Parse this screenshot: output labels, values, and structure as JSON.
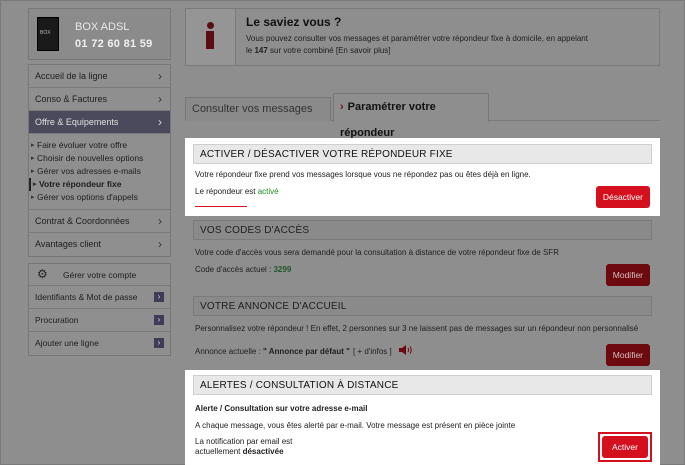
{
  "account_box": {
    "title": "BOX ADSL",
    "number": "01 72 60 81 59",
    "device_icon": "box-adsl-device-icon",
    "device_label": "BOX"
  },
  "menu": {
    "items": [
      {
        "label": "Accueil de la ligne"
      },
      {
        "label": "Conso & Factures"
      },
      {
        "label": "Offre & Equipements"
      }
    ],
    "submenu": [
      {
        "label": "Faire évoluer votre offre"
      },
      {
        "label": "Choisir de nouvelles options"
      },
      {
        "label": "Gérer vos adresses e-mails"
      },
      {
        "label": "Votre répondeur fixe"
      },
      {
        "label": "Gérer vos options d'appels"
      }
    ],
    "items_after": [
      {
        "label": "Contrat & Coordonnées"
      },
      {
        "label": "Avantages client"
      }
    ],
    "chevron": "›"
  },
  "account": {
    "header": "Gérer votre compte",
    "gear_icon": "gear-icon",
    "items": [
      {
        "label": "Identifiants & Mot de passe"
      },
      {
        "label": "Procuration"
      },
      {
        "label": "Ajouter une ligne"
      }
    ],
    "arrow": "›"
  },
  "info": {
    "title": "Le saviez vous ?",
    "line1": "Vous pouvez consulter vos messages et paramétrer votre répondeur fixe à domicile, en appelant",
    "line2_prefix": "le ",
    "line2_number": "147",
    "line2_suffix": " sur votre combiné [En savoir plus]"
  },
  "tabs": {
    "consult": "Consulter vos messages",
    "settings": "Paramétrer votre répondeur",
    "chevron": "›"
  },
  "sections": {
    "activate": {
      "header": "ACTIVER / DÉSACTIVER VOTRE RÉPONDEUR FIXE",
      "desc": "Votre répondeur fixe prend vos messages lorsque vous ne répondez pas ou êtes déjà en ligne.",
      "status_prefix": "Le répondeur est ",
      "status_value": "activé",
      "button": "Désactiver"
    },
    "codes": {
      "header": "VOS CODES D'ACCÈS",
      "desc": "Votre code d'accès vous sera demandé pour la consultation à distance de votre répondeur fixe de SFR",
      "code_label": "Code d'accès actuel : ",
      "code_value": "3299",
      "button": "Modifier"
    },
    "greeting": {
      "header": "VOTRE ANNONCE D'ACCUEIL",
      "desc": "Personnalisez votre répondeur ! En effet, 2 personnes sur 3 ne laissent pas de messages sur un répondeur non personnalisé",
      "current_label": "Annonce actuelle : ",
      "current_value": "\" Annonce par défaut \"",
      "more": "[ + d'infos ]",
      "button": "Modifier"
    },
    "alerts": {
      "header": "ALERTES / CONSULTATION À DISTANCE",
      "subtitle": "Alerte / Consultation sur votre adresse e-mail",
      "desc": "A chaque message, vous êtes alerté par e-mail. Votre message est présent en pièce jointe",
      "notif_line1": "La notification par email est",
      "notif_prefix": "actuellement ",
      "notif_value": "désactivée",
      "button": "Activer"
    }
  }
}
